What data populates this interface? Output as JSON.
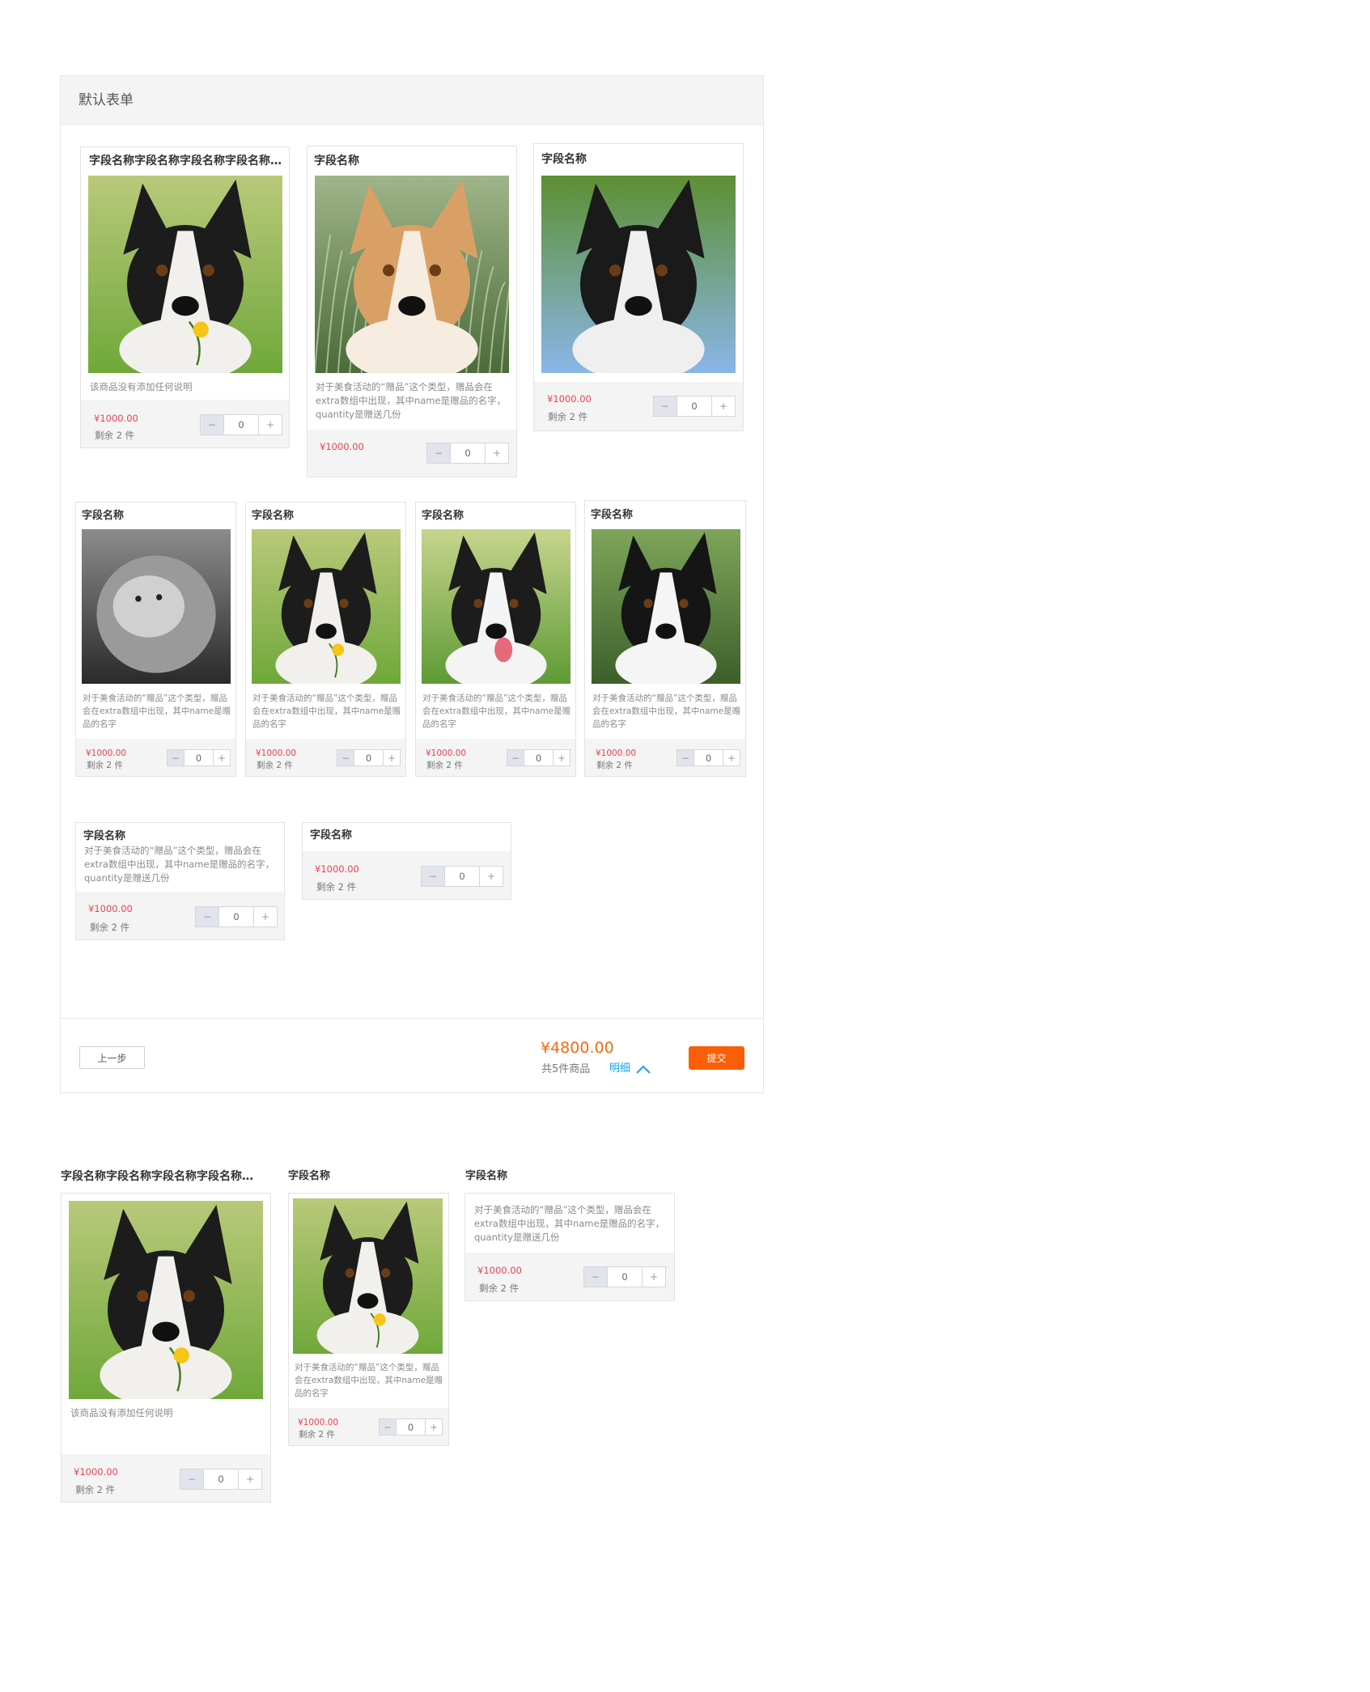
{
  "panel": {
    "title": "默认表单"
  },
  "row1": [
    {
      "title": "字段名称字段名称字段名称字段名称字段名称字段名称",
      "desc": "该商品没有添加任何说明",
      "price": "¥1000.00",
      "stock": "剩余 2 件",
      "qty": "0",
      "minus": "−",
      "plus": "+",
      "photo": "dog-flower"
    },
    {
      "title": "字段名称",
      "desc": "对于美食活动的“赠品”这个类型，赠品会在extra数组中出现，其中name是赠品的名字，quantity是赠送几份",
      "price": "¥1000.00",
      "stock": "",
      "qty": "0",
      "minus": "−",
      "plus": "+",
      "photo": "corgi-grass"
    },
    {
      "title": "字段名称",
      "desc": "",
      "price": "¥1000.00",
      "stock": "剩余 2 件",
      "qty": "0",
      "minus": "−",
      "plus": "+",
      "photo": "dog-sky"
    }
  ],
  "row2": [
    {
      "title": "字段名称",
      "desc": "对于美食活动的“赠品”这个类型，赠品会在extra数组中出现，其中name是赠品的名字",
      "price": "¥1000.00",
      "stock": "剩余 2 件",
      "qty": "0",
      "minus": "−",
      "plus": "+",
      "photo": "dog-bw"
    },
    {
      "title": "字段名称",
      "desc": "对于美食活动的“赠品”这个类型，赠品会在extra数组中出现，其中name是赠品的名字",
      "price": "¥1000.00",
      "stock": "剩余 2 件",
      "qty": "0",
      "minus": "−",
      "plus": "+",
      "photo": "dog-flower"
    },
    {
      "title": "字段名称",
      "desc": "对于美食活动的“赠品”这个类型，赠品会在extra数组中出现，其中name是赠品的名字",
      "price": "¥1000.00",
      "stock": "剩余 2 件",
      "qty": "0",
      "minus": "−",
      "plus": "+",
      "photo": "dog-tongue"
    },
    {
      "title": "字段名称",
      "desc": "对于美食活动的“赠品”这个类型，赠品会在extra数组中出现，其中name是赠品的名字",
      "price": "¥1000.00",
      "stock": "剩余 2 件",
      "qty": "0",
      "minus": "−",
      "plus": "+",
      "photo": "dog-closeup"
    }
  ],
  "row3": [
    {
      "title": "字段名称",
      "desc": "对于美食活动的“赠品”这个类型，赠品会在extra数组中出现，其中name是赠品的名字，quantity是赠送几份",
      "price": "¥1000.00",
      "stock": "剩余 2 件",
      "qty": "0",
      "minus": "−",
      "plus": "+"
    },
    {
      "title": "字段名称",
      "desc": "",
      "price": "¥1000.00",
      "stock": "剩余 2 件",
      "qty": "0",
      "minus": "−",
      "plus": "+"
    }
  ],
  "footer": {
    "prev_label": "上一步",
    "total": "¥4800.00",
    "count": "共5件商品",
    "detail_label": "明细",
    "submit_label": "提交"
  },
  "samples": [
    {
      "title": "字段名称字段名称字段名称字段名称字段名称字段名称",
      "desc": "该商品没有添加任何说明",
      "price": "¥1000.00",
      "stock": "剩余 2 件",
      "qty": "0",
      "minus": "−",
      "plus": "+",
      "photo": "dog-flower"
    },
    {
      "title": "字段名称",
      "desc": "对于美食活动的“赠品”这个类型，赠品会在extra数组中出现，其中name是赠品的名字",
      "price": "¥1000.00",
      "stock": "剩余 2 件",
      "qty": "0",
      "minus": "−",
      "plus": "+",
      "photo": "dog-flower"
    },
    {
      "title": "字段名称",
      "desc": "对于美食活动的“赠品”这个类型，赠品会在extra数组中出现，其中name是赠品的名字，quantity是赠送几份",
      "price": "¥1000.00",
      "stock": "剩余 2 件",
      "qty": "0",
      "minus": "−",
      "plus": "+"
    }
  ],
  "colors": {
    "price": "#e8434f",
    "total": "#f26b12",
    "submit": "#fa5f07",
    "detail": "#1aa3e8"
  }
}
